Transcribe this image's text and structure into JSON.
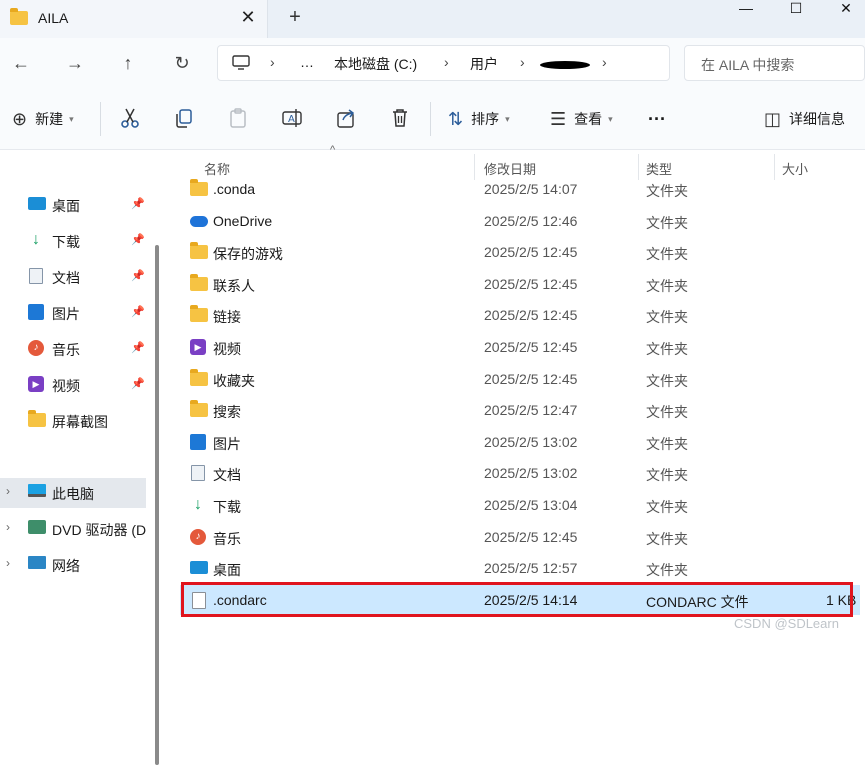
{
  "tab": {
    "title": "AILA",
    "close": "✕",
    "new_tab": "+"
  },
  "window_controls": {
    "minimize": "—",
    "maximize": "☐",
    "close": "✕"
  },
  "nav": {
    "back": "←",
    "forward": "→",
    "up": "↑",
    "refresh": "↻",
    "breadcrumb": [
      "…",
      "本地磁盘 (C:)",
      "用户"
    ],
    "search_placeholder": "在 AILA 中搜索"
  },
  "commands": {
    "new_label": "新建",
    "sort_label": "排序",
    "view_label": "查看",
    "more": "···",
    "details_label": "详细信息"
  },
  "sidebar": {
    "quick_access": [
      {
        "label": "桌面",
        "icon": "desktop-icon"
      },
      {
        "label": "下载",
        "icon": "download-icon"
      },
      {
        "label": "文档",
        "icon": "document-icon"
      },
      {
        "label": "图片",
        "icon": "pictures-icon"
      },
      {
        "label": "音乐",
        "icon": "music-icon"
      },
      {
        "label": "视频",
        "icon": "video-icon"
      },
      {
        "label": "屏幕截图",
        "icon": "folder-icon"
      }
    ],
    "devices": [
      {
        "label": "此电脑",
        "icon": "pc-icon",
        "selected": true
      },
      {
        "label": "DVD 驱动器 (D",
        "icon": "dvd-icon"
      },
      {
        "label": "网络",
        "icon": "network-icon"
      }
    ]
  },
  "columns": {
    "name": "名称",
    "date": "修改日期",
    "type": "类型",
    "size": "大小"
  },
  "files": [
    {
      "name": ".conda",
      "date": "2025/2/5 14:07",
      "type": "文件夹",
      "size": "",
      "icon": "folder-icon"
    },
    {
      "name": "OneDrive",
      "date": "2025/2/5 12:46",
      "type": "文件夹",
      "size": "",
      "icon": "cloud-icon"
    },
    {
      "name": "保存的游戏",
      "date": "2025/2/5 12:45",
      "type": "文件夹",
      "size": "",
      "icon": "folder-icon"
    },
    {
      "name": "联系人",
      "date": "2025/2/5 12:45",
      "type": "文件夹",
      "size": "",
      "icon": "folder-icon"
    },
    {
      "name": "链接",
      "date": "2025/2/5 12:45",
      "type": "文件夹",
      "size": "",
      "icon": "folder-icon"
    },
    {
      "name": "视频",
      "date": "2025/2/5 12:45",
      "type": "文件夹",
      "size": "",
      "icon": "video-icon"
    },
    {
      "name": "收藏夹",
      "date": "2025/2/5 12:45",
      "type": "文件夹",
      "size": "",
      "icon": "folder-icon"
    },
    {
      "name": "搜索",
      "date": "2025/2/5 12:47",
      "type": "文件夹",
      "size": "",
      "icon": "folder-icon"
    },
    {
      "name": "图片",
      "date": "2025/2/5 13:02",
      "type": "文件夹",
      "size": "",
      "icon": "pictures-icon"
    },
    {
      "name": "文档",
      "date": "2025/2/5 13:02",
      "type": "文件夹",
      "size": "",
      "icon": "document-icon"
    },
    {
      "name": "下载",
      "date": "2025/2/5 13:04",
      "type": "文件夹",
      "size": "",
      "icon": "download-icon"
    },
    {
      "name": "音乐",
      "date": "2025/2/5 12:45",
      "type": "文件夹",
      "size": "",
      "icon": "music-icon"
    },
    {
      "name": "桌面",
      "date": "2025/2/5 12:57",
      "type": "文件夹",
      "size": "",
      "icon": "desktop-icon"
    },
    {
      "name": ".condarc",
      "date": "2025/2/5 14:14",
      "type": "CONDARC 文件",
      "size": "1 KB",
      "icon": "file-icon",
      "selected": true
    }
  ],
  "colors": {
    "selection": "#cce8ff",
    "highlight_border": "#e0141e",
    "accent": "#2c5d9a"
  },
  "watermark": "CSDN @SDLearn"
}
